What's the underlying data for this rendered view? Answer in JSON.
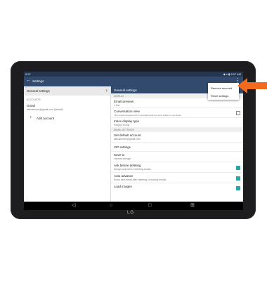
{
  "statusbar": {
    "time": "8:57",
    "right": "◆ ▾ ▮ 8:57 AM"
  },
  "appbar": {
    "title": "Settings"
  },
  "left": {
    "general": "General settings",
    "accounts_header": "ACCOUNTS",
    "account_name": "Gmail",
    "account_email": "attcustomer@gmail.com (default)",
    "add_account": "Add account"
  },
  "right": {
    "header": "General settings",
    "sec_display": "DISPLAY",
    "email_preview_title": "Email preview",
    "email_preview_sub": "1 line",
    "conversation_title": "Conversation view",
    "conversation_sub": "View emails navigated with or associated with the same subject in one thread",
    "inbox_title": "Inbox display type",
    "inbox_sub": "Subject on top",
    "sec_email": "EMAIL SETTINGS",
    "default_title": "Set default account",
    "default_sub": "attcustomer@gmail.com",
    "vip_title": "VIP settings",
    "save_title": "Save to",
    "save_sub": "Internal storage",
    "askdel_title": "Ask before deleting",
    "askdel_sub": "Always ask before deleting emails",
    "autoadv_title": "Auto advance",
    "autoadv_sub": "Show next email after deleting or moving emails",
    "last_title": "Load images"
  },
  "menu": {
    "remove": "Remove account",
    "reset": "Reset settings"
  },
  "device": {
    "logo": "LG"
  },
  "colors": {
    "accent": "#324a6d",
    "status": "#243650",
    "arrow": "#f26a1b",
    "checked": "#2aa6a6"
  }
}
